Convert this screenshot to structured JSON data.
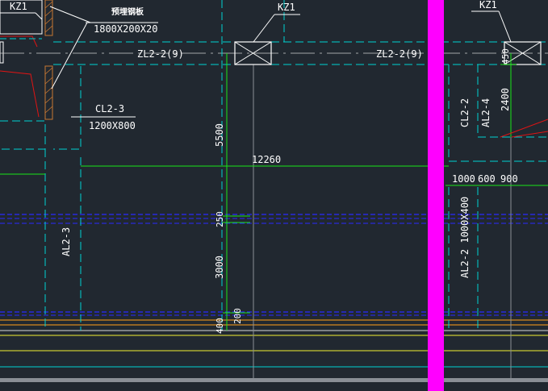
{
  "colors": {
    "background": "#212830",
    "white": "#ffffff",
    "cyan": "#00d2d2",
    "green": "#19e619",
    "magenta": "#ff00ff",
    "blue": "#2a2aff",
    "orange": "#d6881e",
    "yellow": "#c8c832",
    "red": "#e01414",
    "gray": "#8a8f96",
    "hatch": "#c87832"
  },
  "labels": {
    "kz1_left": "KZ1",
    "kz1_center": "KZ1",
    "kz1_right": "KZ1",
    "embedded_plate": "预埋钢板",
    "embedded_plate_size": "1800X200X20",
    "cl2_3": "CL2-3",
    "cl2_3_size": "1200X800",
    "zl2_2_left": "ZL2-2(9)",
    "zl2_2_right": "ZL2-2(9)",
    "cl2_2": "CL2-2",
    "al2_4": "AL2-4",
    "al2_3": "AL2-3",
    "al2_2": "AL2-2  1000X400"
  },
  "dimensions": {
    "d12260": "12260",
    "d5500": "5500",
    "d250": "250",
    "d3000": "3000",
    "d200": "200",
    "d400": "400",
    "d1000": "1000",
    "d600": "600",
    "d900": "900",
    "d2400": "2400",
    "d450": "450"
  }
}
